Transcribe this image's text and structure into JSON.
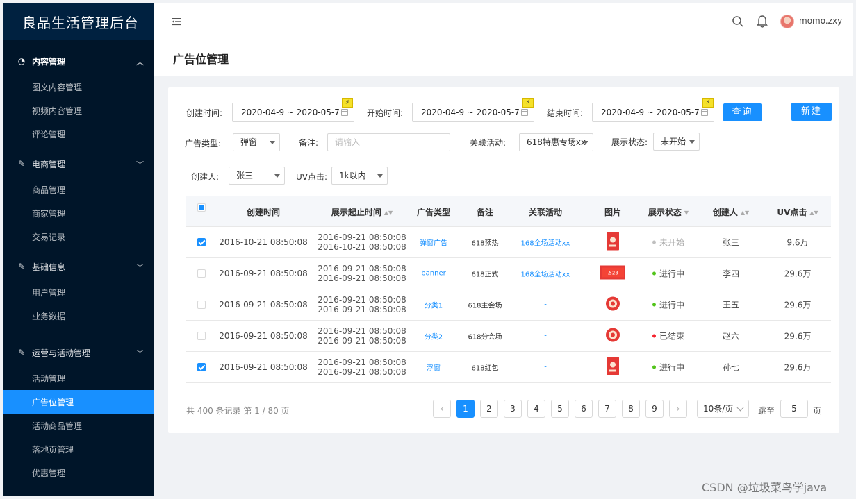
{
  "brand": "良品生活管理后台",
  "sidebar": {
    "groups": [
      {
        "title": "内容管理",
        "icon": "dashboard-icon",
        "items": [
          "图文内容管理",
          "视频内容管理",
          "评论管理"
        ]
      },
      {
        "title": "电商管理",
        "icon": "edit-icon",
        "items": [
          "商品管理",
          "商家管理",
          "交易记录"
        ]
      },
      {
        "title": "基础信息",
        "icon": "edit-icon",
        "items": [
          "用户管理",
          "业务数据"
        ]
      },
      {
        "title": "运营与活动管理",
        "icon": "edit-icon",
        "items": [
          "活动管理",
          "广告位管理",
          "活动商品管理",
          "落地页管理",
          "优惠管理"
        ]
      }
    ],
    "active_item": "广告位管理"
  },
  "header": {
    "username": "momo.zxy"
  },
  "page_title": "广告位管理",
  "filters": {
    "created_label": "创建时间:",
    "created_value": "2020-04-9 ~ 2020-05-7",
    "start_label": "开始时间:",
    "start_value": "2020-04-9 ~ 2020-05-7",
    "end_label": "结束时间:",
    "end_value": "2020-04-9 ~ 2020-05-7",
    "query_button": "查询",
    "new_button": "新建",
    "ad_type_label": "广告类型:",
    "ad_type_value": "弹窗",
    "note_label": "备注:",
    "note_placeholder": "请输入",
    "activity_label": "关联活动:",
    "activity_value": "618特惠专场xx",
    "status_label": "展示状态:",
    "status_value": "未开始",
    "creator_label": "创建人:",
    "creator_value": "张三",
    "uv_label": "UV点击:",
    "uv_value": "1k以内"
  },
  "table": {
    "columns": [
      "创建时间",
      "展示起止时间",
      "广告类型",
      "备注",
      "关联活动",
      "图片",
      "展示状态",
      "创建人",
      "UV点击"
    ],
    "rows": [
      {
        "checked": true,
        "created": "2016-10-21  08:50:08",
        "range_start": "2016-09-21  08:50:08",
        "range_end": "2016-10-21  08:50:08",
        "type": "弹窗广告",
        "note": "618预热",
        "activity": "168全场活动xx",
        "status": "未开始",
        "status_color": "#bfbfbf",
        "creator": "张三",
        "uv": "9.6万",
        "image": "redbag-icon"
      },
      {
        "checked": false,
        "created": "2016-09-21  08:50:08",
        "range_start": "2016-09-21  08:50:08",
        "range_end": "2016-09-21  08:50:08",
        "type": "banner",
        "note": "618正式",
        "activity": "168全场活动xx",
        "status": "进行中",
        "status_color": "#52c41a",
        "creator": "李四",
        "uv": "29.6万",
        "image": "banner-icon"
      },
      {
        "checked": false,
        "created": "2016-09-21  08:50:08",
        "range_start": "2016-09-21  08:50:08",
        "range_end": "2016-09-21  08:50:08",
        "type": "分类1",
        "note": "618主会场",
        "activity": "-",
        "status": "进行中",
        "status_color": "#52c41a",
        "creator": "王五",
        "uv": "29.6万",
        "image": "coupon-icon"
      },
      {
        "checked": false,
        "created": "2016-09-21  08:50:08",
        "range_start": "2016-09-21  08:50:08",
        "range_end": "2016-09-21  08:50:08",
        "type": "分类2",
        "note": "618分会场",
        "activity": "-",
        "status": "已结束",
        "status_color": "#f5222d",
        "creator": "赵六",
        "uv": "29.6万",
        "image": "coupon-icon"
      },
      {
        "checked": true,
        "created": "2016-09-21  08:50:08",
        "range_start": "2016-09-21  08:50:08",
        "range_end": "2016-09-21  08:50:08",
        "type": "浮窗",
        "note": "618红包",
        "activity": "-",
        "status": "进行中",
        "status_color": "#52c41a",
        "creator": "孙七",
        "uv": "29.6万",
        "image": "redbag-icon"
      }
    ]
  },
  "pagination": {
    "total_text": "共 400 条记录 第 1 / 80 页",
    "pages": [
      "1",
      "2",
      "3",
      "4",
      "5",
      "6",
      "7",
      "8",
      "9"
    ],
    "page_size": "10条/页",
    "jump_label": "跳至",
    "jump_value": "5",
    "page_suffix": "页"
  },
  "watermark": "CSDN @垃圾菜鸟学java",
  "colors": {
    "sidebar_bg": "#001529",
    "accent": "#1890ff"
  }
}
